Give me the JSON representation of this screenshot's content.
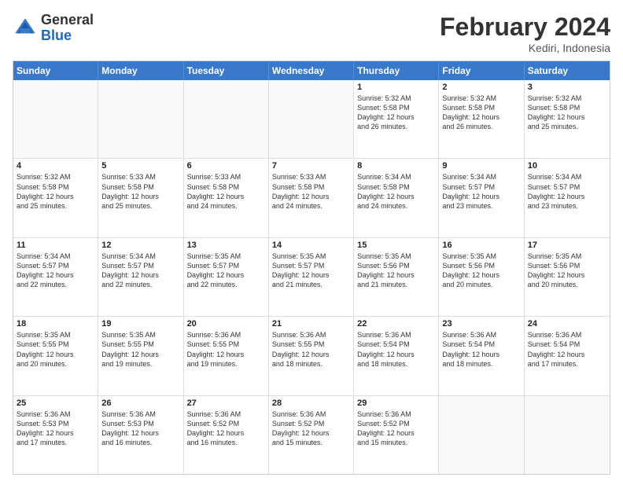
{
  "header": {
    "logo": {
      "general": "General",
      "blue": "Blue"
    },
    "title": "February 2024",
    "location": "Kediri, Indonesia"
  },
  "weekdays": [
    "Sunday",
    "Monday",
    "Tuesday",
    "Wednesday",
    "Thursday",
    "Friday",
    "Saturday"
  ],
  "rows": [
    [
      {
        "day": "",
        "info": ""
      },
      {
        "day": "",
        "info": ""
      },
      {
        "day": "",
        "info": ""
      },
      {
        "day": "",
        "info": ""
      },
      {
        "day": "1",
        "info": "Sunrise: 5:32 AM\nSunset: 5:58 PM\nDaylight: 12 hours\nand 26 minutes."
      },
      {
        "day": "2",
        "info": "Sunrise: 5:32 AM\nSunset: 5:58 PM\nDaylight: 12 hours\nand 26 minutes."
      },
      {
        "day": "3",
        "info": "Sunrise: 5:32 AM\nSunset: 5:58 PM\nDaylight: 12 hours\nand 25 minutes."
      }
    ],
    [
      {
        "day": "4",
        "info": "Sunrise: 5:32 AM\nSunset: 5:58 PM\nDaylight: 12 hours\nand 25 minutes."
      },
      {
        "day": "5",
        "info": "Sunrise: 5:33 AM\nSunset: 5:58 PM\nDaylight: 12 hours\nand 25 minutes."
      },
      {
        "day": "6",
        "info": "Sunrise: 5:33 AM\nSunset: 5:58 PM\nDaylight: 12 hours\nand 24 minutes."
      },
      {
        "day": "7",
        "info": "Sunrise: 5:33 AM\nSunset: 5:58 PM\nDaylight: 12 hours\nand 24 minutes."
      },
      {
        "day": "8",
        "info": "Sunrise: 5:34 AM\nSunset: 5:58 PM\nDaylight: 12 hours\nand 24 minutes."
      },
      {
        "day": "9",
        "info": "Sunrise: 5:34 AM\nSunset: 5:57 PM\nDaylight: 12 hours\nand 23 minutes."
      },
      {
        "day": "10",
        "info": "Sunrise: 5:34 AM\nSunset: 5:57 PM\nDaylight: 12 hours\nand 23 minutes."
      }
    ],
    [
      {
        "day": "11",
        "info": "Sunrise: 5:34 AM\nSunset: 5:57 PM\nDaylight: 12 hours\nand 22 minutes."
      },
      {
        "day": "12",
        "info": "Sunrise: 5:34 AM\nSunset: 5:57 PM\nDaylight: 12 hours\nand 22 minutes."
      },
      {
        "day": "13",
        "info": "Sunrise: 5:35 AM\nSunset: 5:57 PM\nDaylight: 12 hours\nand 22 minutes."
      },
      {
        "day": "14",
        "info": "Sunrise: 5:35 AM\nSunset: 5:57 PM\nDaylight: 12 hours\nand 21 minutes."
      },
      {
        "day": "15",
        "info": "Sunrise: 5:35 AM\nSunset: 5:56 PM\nDaylight: 12 hours\nand 21 minutes."
      },
      {
        "day": "16",
        "info": "Sunrise: 5:35 AM\nSunset: 5:56 PM\nDaylight: 12 hours\nand 20 minutes."
      },
      {
        "day": "17",
        "info": "Sunrise: 5:35 AM\nSunset: 5:56 PM\nDaylight: 12 hours\nand 20 minutes."
      }
    ],
    [
      {
        "day": "18",
        "info": "Sunrise: 5:35 AM\nSunset: 5:55 PM\nDaylight: 12 hours\nand 20 minutes."
      },
      {
        "day": "19",
        "info": "Sunrise: 5:35 AM\nSunset: 5:55 PM\nDaylight: 12 hours\nand 19 minutes."
      },
      {
        "day": "20",
        "info": "Sunrise: 5:36 AM\nSunset: 5:55 PM\nDaylight: 12 hours\nand 19 minutes."
      },
      {
        "day": "21",
        "info": "Sunrise: 5:36 AM\nSunset: 5:55 PM\nDaylight: 12 hours\nand 18 minutes."
      },
      {
        "day": "22",
        "info": "Sunrise: 5:36 AM\nSunset: 5:54 PM\nDaylight: 12 hours\nand 18 minutes."
      },
      {
        "day": "23",
        "info": "Sunrise: 5:36 AM\nSunset: 5:54 PM\nDaylight: 12 hours\nand 18 minutes."
      },
      {
        "day": "24",
        "info": "Sunrise: 5:36 AM\nSunset: 5:54 PM\nDaylight: 12 hours\nand 17 minutes."
      }
    ],
    [
      {
        "day": "25",
        "info": "Sunrise: 5:36 AM\nSunset: 5:53 PM\nDaylight: 12 hours\nand 17 minutes."
      },
      {
        "day": "26",
        "info": "Sunrise: 5:36 AM\nSunset: 5:53 PM\nDaylight: 12 hours\nand 16 minutes."
      },
      {
        "day": "27",
        "info": "Sunrise: 5:36 AM\nSunset: 5:52 PM\nDaylight: 12 hours\nand 16 minutes."
      },
      {
        "day": "28",
        "info": "Sunrise: 5:36 AM\nSunset: 5:52 PM\nDaylight: 12 hours\nand 15 minutes."
      },
      {
        "day": "29",
        "info": "Sunrise: 5:36 AM\nSunset: 5:52 PM\nDaylight: 12 hours\nand 15 minutes."
      },
      {
        "day": "",
        "info": ""
      },
      {
        "day": "",
        "info": ""
      }
    ]
  ]
}
